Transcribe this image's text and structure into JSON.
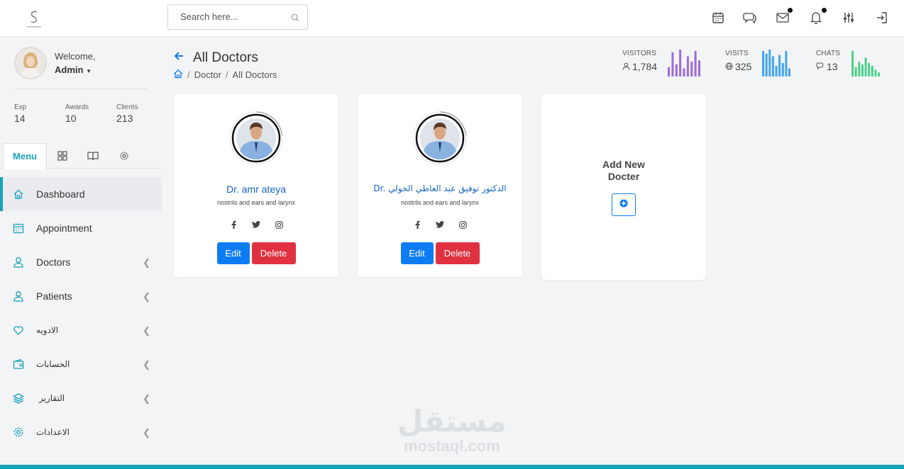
{
  "header": {
    "search_placeholder": "Search here...",
    "icons": [
      "calendar-icon",
      "chat-icon",
      "mail-icon",
      "bell-icon",
      "sliders-icon",
      "logout-icon"
    ]
  },
  "profile": {
    "welcome": "Welcome,",
    "name": "Admin",
    "stats": [
      {
        "label": "Exp",
        "value": "14"
      },
      {
        "label": "Awards",
        "value": "10"
      },
      {
        "label": "Clients",
        "value": "213"
      }
    ]
  },
  "menu_tab": "Menu",
  "nav": [
    {
      "label": "Dashboard",
      "icon": "home-icon"
    },
    {
      "label": "Appointment",
      "icon": "calendar-icon"
    },
    {
      "label": "Doctors",
      "icon": "user-icon"
    },
    {
      "label": "Patients",
      "icon": "user-icon"
    },
    {
      "label": "الادويه",
      "icon": "heart-icon"
    },
    {
      "label": "الحسابات",
      "icon": "wallet-icon"
    },
    {
      "label": "التقارير",
      "icon": "layers-icon"
    },
    {
      "label": "الاعدادات",
      "icon": "gear-icon"
    }
  ],
  "page": {
    "title": "All Doctors",
    "breadcrumb": [
      "Doctor",
      "All Doctors"
    ]
  },
  "kpis": [
    {
      "label": "VISITORS",
      "value": "1,784",
      "color": "#9c6ade",
      "bars": [
        0.35,
        0.9,
        0.45,
        1.0,
        0.3,
        0.75,
        0.55,
        0.95,
        0.6
      ]
    },
    {
      "label": "VISITS",
      "value": "325",
      "color": "#42a5f5",
      "bars": [
        0.95,
        0.85,
        1.0,
        0.75,
        0.4,
        0.8,
        0.5,
        0.95,
        0.3
      ]
    },
    {
      "label": "CHATS",
      "value": "13",
      "color": "#4cd08a",
      "bars": [
        0.95,
        0.35,
        0.55,
        0.45,
        0.7,
        0.5,
        0.4,
        0.25,
        0.15
      ]
    }
  ],
  "doctors": [
    {
      "name": "Dr. amr ateya",
      "specialty": "nostrils and ears and larynx"
    },
    {
      "name": "Dr. الدكتور توفيق عبد العاطي الخولي",
      "specialty": "nostrils and ears and larynx"
    }
  ],
  "actions": {
    "edit": "Edit",
    "delete": "Delete"
  },
  "add_card": {
    "line1": "Add New",
    "line2": "Docter"
  },
  "watermark": {
    "arabic": "مستقل",
    "latin": "mostaql.com"
  },
  "colors": {
    "accent": "#17a2b8",
    "primary": "#0d7cf2",
    "danger": "#e03140"
  }
}
